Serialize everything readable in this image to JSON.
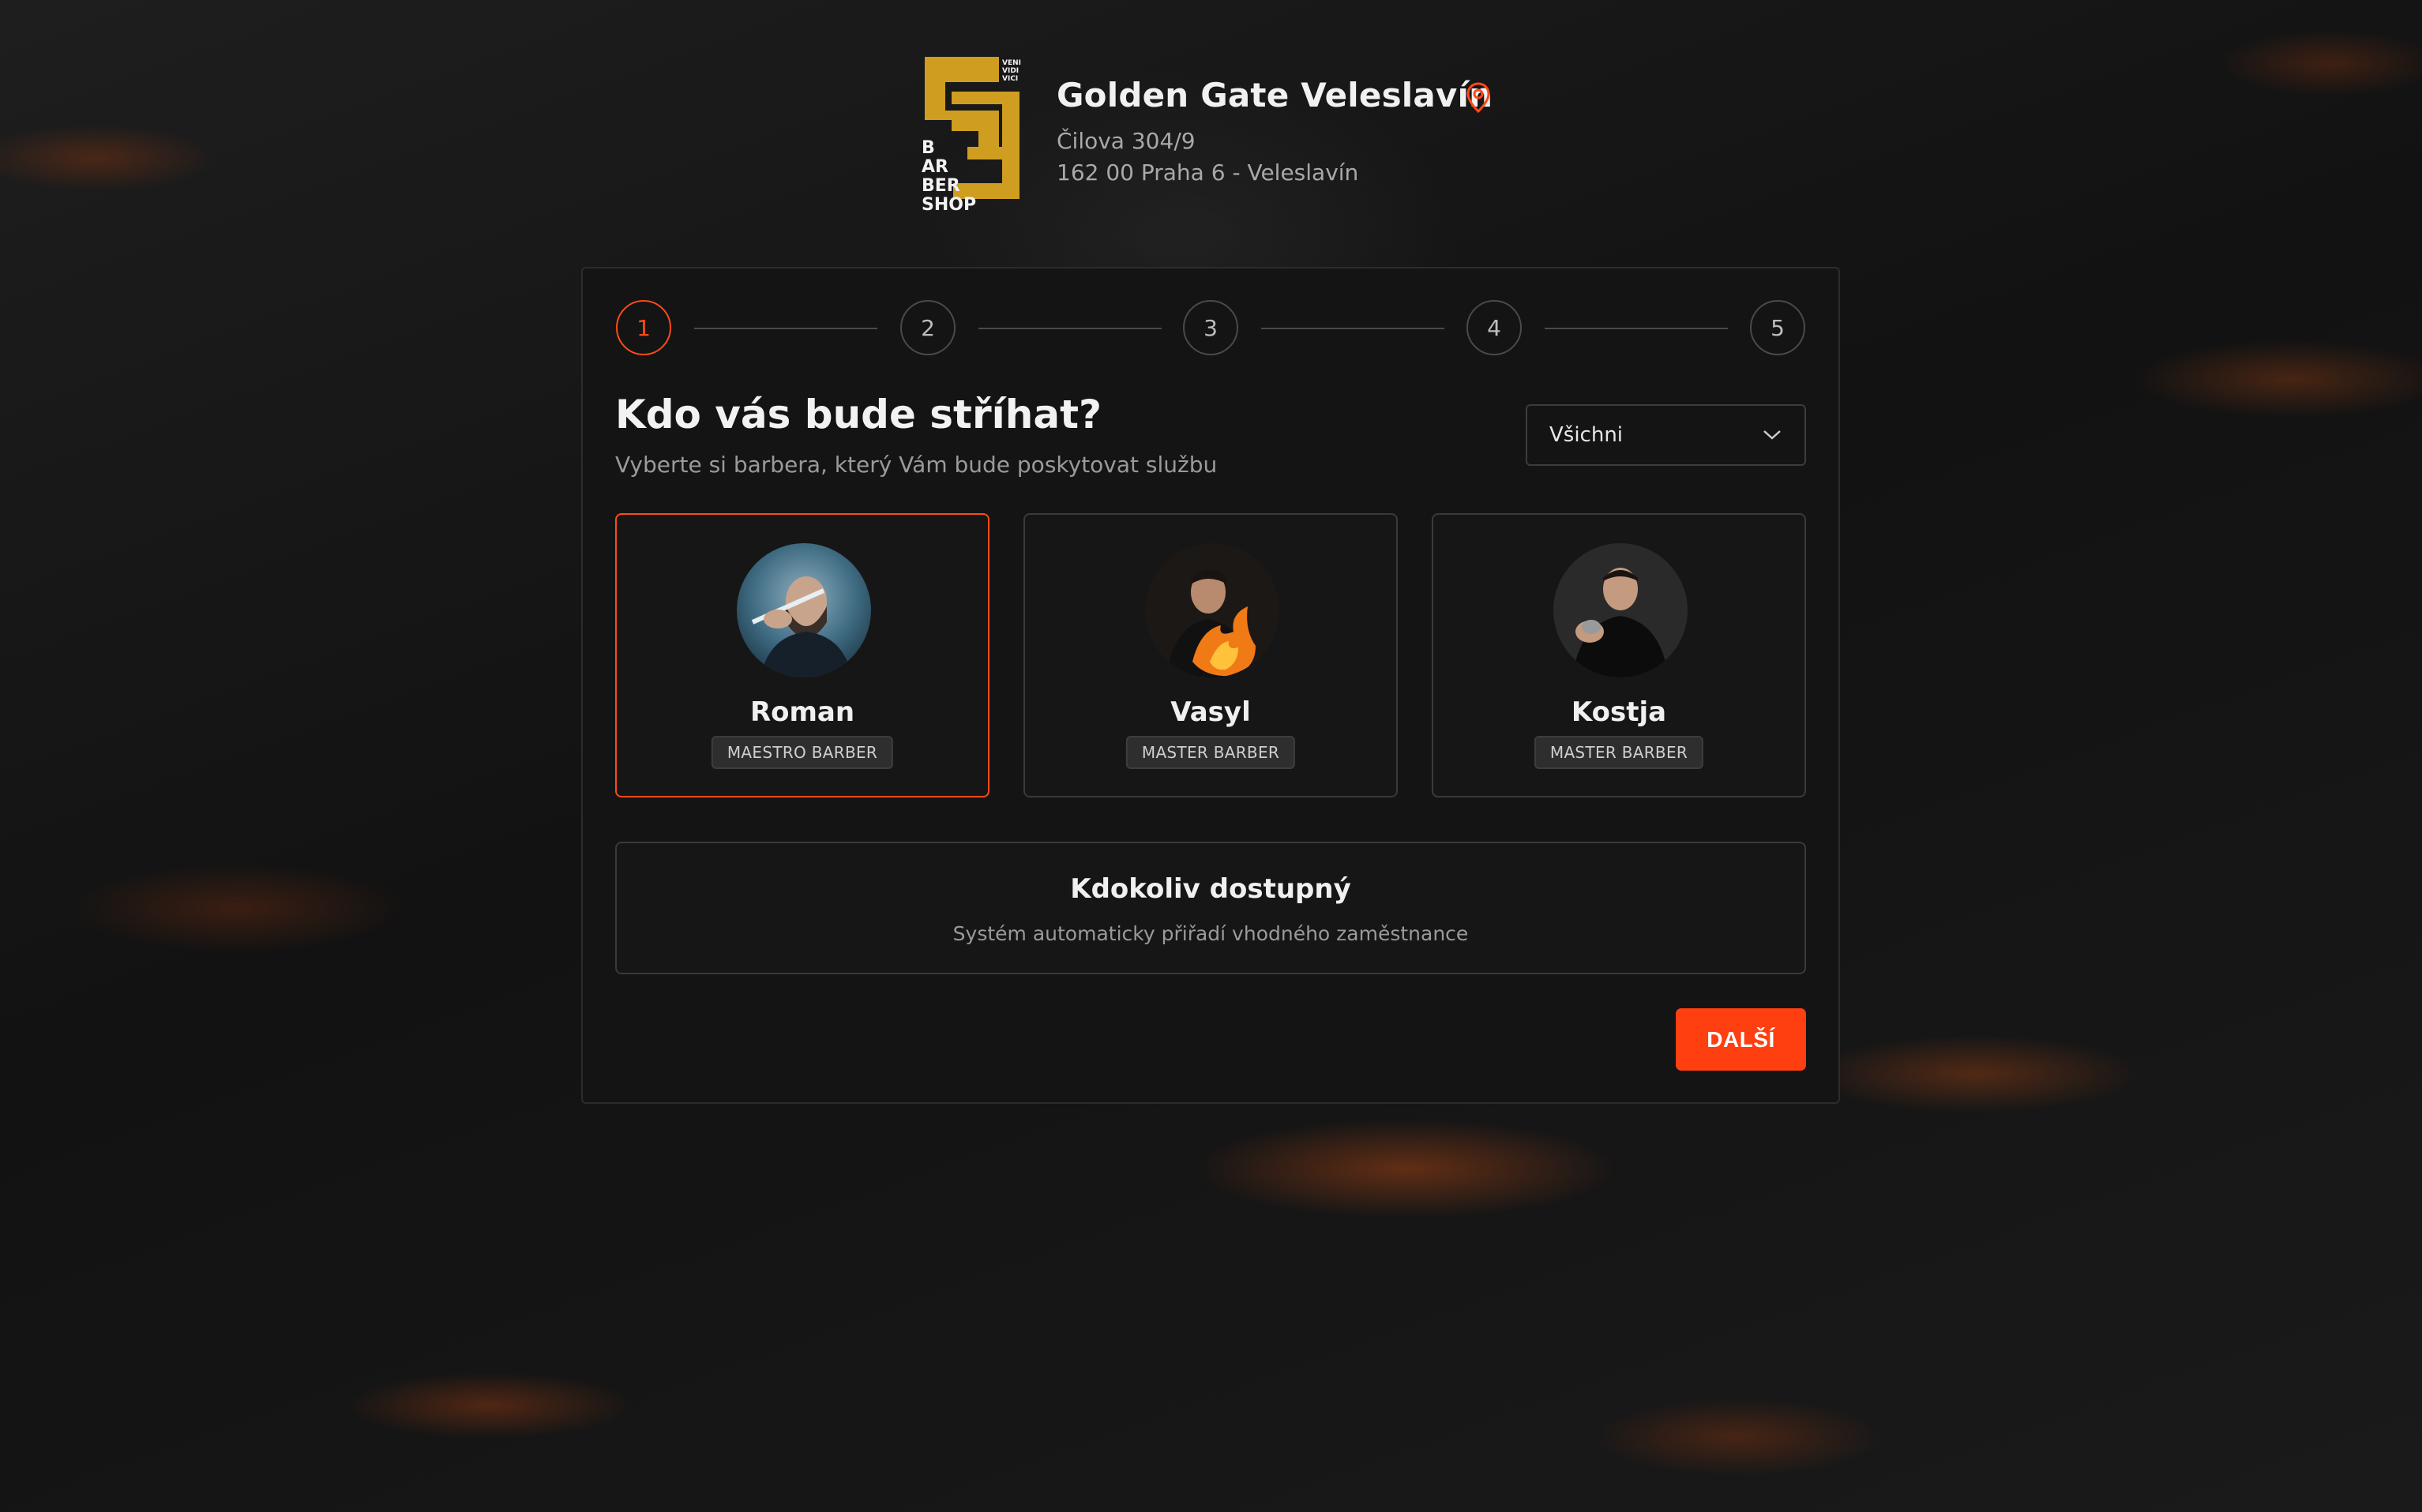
{
  "brand": {
    "logo_text": [
      "VENI",
      "VIDI",
      "VICI",
      "B",
      "AR",
      "BER",
      "SHOP"
    ],
    "logo_color": "#d9a521"
  },
  "location": {
    "name": "Golden Gate Veleslavín",
    "address_line1": "Čilova 304/9",
    "address_line2": "162 00 Praha 6 - Veleslavín",
    "pin_icon": "map-pin-icon"
  },
  "stepper": {
    "steps": [
      "1",
      "2",
      "3",
      "4",
      "5"
    ],
    "active_step": 1
  },
  "heading": {
    "title": "Kdo vás bude stříhat?",
    "subtitle": "Vyberte si barbera, který Vám bude poskytovat službu"
  },
  "filter": {
    "value": "Všichni",
    "icon": "chevron-down-icon"
  },
  "barbers": [
    {
      "name": "Roman",
      "role": "MAESTRO BARBER",
      "selected": true
    },
    {
      "name": "Vasyl",
      "role": "MASTER BARBER",
      "selected": false
    },
    {
      "name": "Kostja",
      "role": "MASTER BARBER",
      "selected": false
    }
  ],
  "anyone": {
    "title": "Kdokoliv dostupný",
    "subtitle": "Systém automaticky přiřadí vhodného zaměstnance"
  },
  "next_button": {
    "label": "DALŠÍ"
  },
  "colors": {
    "accent": "#ff4a17",
    "background": "#141414",
    "border": "#3a3a3a"
  }
}
